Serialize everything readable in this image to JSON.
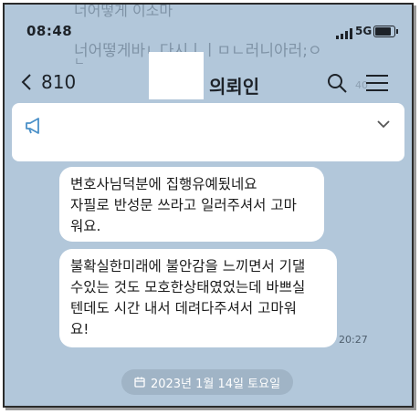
{
  "status_bar": {
    "time": "08:48",
    "network": "5G",
    "battery_level": 0.9
  },
  "ghost_text": {
    "line1": "너어떻게 이소마",
    "line2": "너어떻게바ㄴ다시ㅣㅣㅁㄴ러니아러;ㅇ",
    "line3": "ㄴ",
    "time": "40"
  },
  "header": {
    "back_count": "810",
    "title": "의뢰인"
  },
  "notice": {},
  "messages": [
    {
      "lines": [
        "변호사님덕분에 집행유예됬네요",
        "자필로 반성문 쓰라고 일러주셔서 고마",
        "워요."
      ]
    },
    {
      "lines": [
        "불확실한미래에 불안감을 느끼면서 기댈",
        "수있는 것도 모호한상태였었는데 바쁘실",
        "텐데도 시간 내서 데려다주셔서 고마워",
        "요!"
      ],
      "time": "20:27"
    }
  ],
  "date_divider": {
    "label": "2023년 1월 14일 토요일"
  },
  "colors": {
    "chat_background": "#b2c7da",
    "bubble": "#ffffff",
    "date_pill": "#a0b4c6"
  }
}
